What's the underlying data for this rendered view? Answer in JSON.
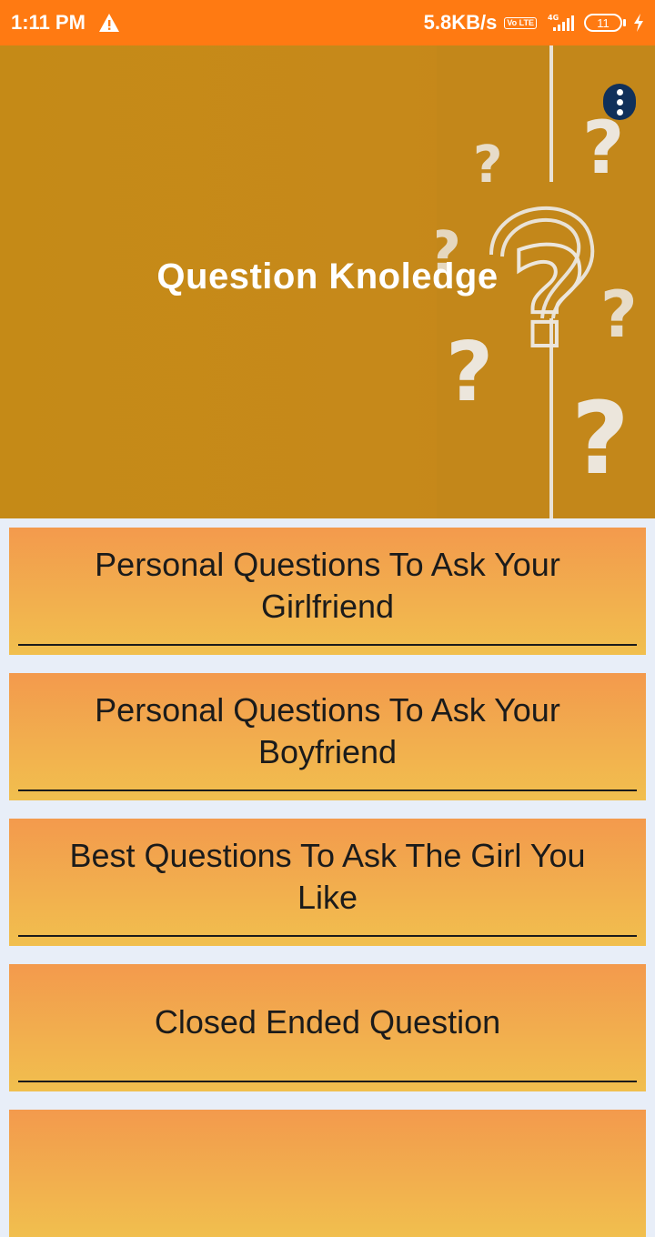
{
  "status_bar": {
    "time": "1:11 PM",
    "speed": "5.8KB/s",
    "volte": "Vo LTE",
    "network": "4G",
    "battery": "11"
  },
  "header": {
    "title": "Question Knoledge",
    "menu_icon": "more-vert-icon"
  },
  "items": [
    {
      "label": "Personal Questions To Ask Your Girlfriend"
    },
    {
      "label": "Personal Questions To Ask Your Boyfriend"
    },
    {
      "label": "Best Questions To Ask The Girl You Like"
    },
    {
      "label": "Closed Ended Question"
    },
    {
      "label": ""
    }
  ],
  "colors": {
    "status_bar": "#ff7a12",
    "banner": "#c58a17",
    "card_top": "#f39a4d",
    "card_bottom": "#f1bf4e",
    "menu_button": "#10305a"
  }
}
